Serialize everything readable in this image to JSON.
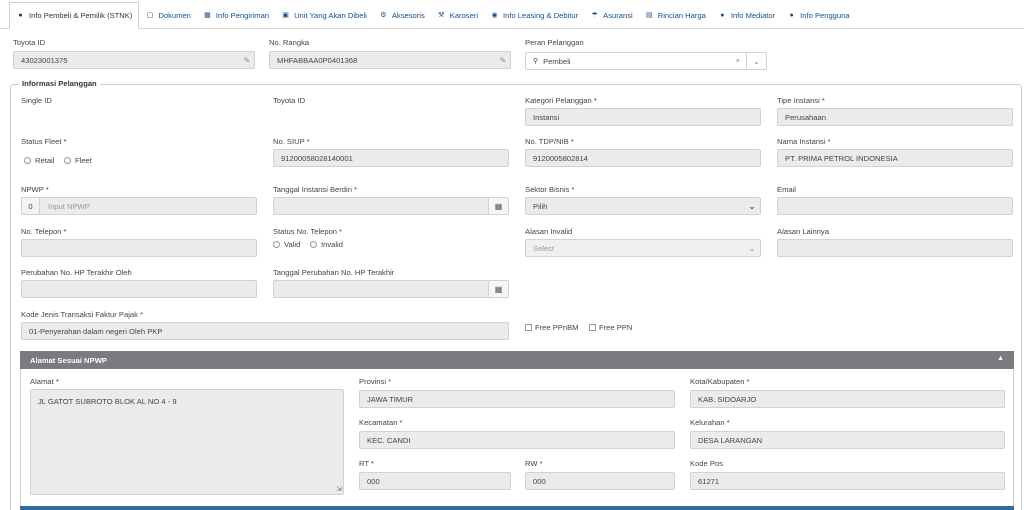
{
  "tabs": [
    {
      "label": "Info Pembeli & Pemilik (STNK)",
      "icon": "user-icon"
    },
    {
      "label": "Dokumen",
      "icon": "folder-icon"
    },
    {
      "label": "Info Pengiriman",
      "icon": "map-icon"
    },
    {
      "label": "Unit Yang Akan Dibeli",
      "icon": "car-icon"
    },
    {
      "label": "Aksesoris",
      "icon": "cogs-icon"
    },
    {
      "label": "Karoseri",
      "icon": "wrench-icon"
    },
    {
      "label": "Info Leasing & Debitur",
      "icon": "handshake-icon"
    },
    {
      "label": "Asuransi",
      "icon": "umbrella-icon"
    },
    {
      "label": "Rincian Harga",
      "icon": "money-icon"
    },
    {
      "label": "Info Mediator",
      "icon": "users-icon"
    },
    {
      "label": "Info Pengguna",
      "icon": "user-icon"
    }
  ],
  "top": {
    "toyota_id_label": "Toyota ID",
    "toyota_id_value": "43023001375",
    "rangka_label": "No. Rangka",
    "rangka_value": "MHFABBAA0P0401368",
    "peran_label": "Peran Pelanggan",
    "peran_value": "Pembeli",
    "clear_symbol": "×",
    "dropdown_symbol": "⌄"
  },
  "info": {
    "legend": "Informasi Pelanggan",
    "single_id_label": "Single ID",
    "toyota_id_label": "Toyota ID",
    "kategori_label": "Kategori Pelanggan *",
    "kategori_value": "Instansi",
    "tipe_label": "Tipe Instansi *",
    "tipe_value": "Perusahaan",
    "status_fleet_label": "Status Fleet *",
    "retail_label": "Retail",
    "fleet_label": "Fleet",
    "siup_label": "No. SIUP *",
    "siup_value": "91200058028140001",
    "tdp_label": "No. TDP/NIB *",
    "tdp_value": "9120005802814",
    "nama_label": "Nama Instansi *",
    "nama_value": "PT. PRIMA PETROL INDONESIA",
    "npwp_label": "NPWP *",
    "npwp_prefix": "0",
    "npwp_placeholder": "Input NPWP",
    "tgl_berdiri_label": "Tanggal Instansi Berdiri *",
    "sektor_label": "Sektor Bisnis *",
    "sektor_value": "Pilih",
    "email_label": "Email",
    "telepon_label": "No. Telepon *",
    "status_telepon_label": "Status No. Telepon *",
    "valid_label": "Valid",
    "invalid_label": "Invalid",
    "alasan_invalid_label": "Alasan Invalid",
    "alasan_invalid_value": "Select",
    "alasan_lainnya_label": "Alasan Lainnya",
    "perubahan_hp_label": "Perubahan No. HP Terakhir Oleh",
    "tgl_perubahan_label": "Tanggal Perubahan No. HP Terakhir",
    "kode_pajak_label": "Kode Jenis Transaksi Faktur Pajak *",
    "kode_pajak_value": "01-Penyerahan dalam negeri Oleh PKP",
    "free_ppnbm_label": "Free PPnBM",
    "free_ppn_label": "Free PPN"
  },
  "alamat": {
    "header": "Alamat Sesuai NPWP",
    "alamat_label": "Alamat *",
    "alamat_value": "JL GATOT SUBROTO BLOK AL NO 4 - 9",
    "provinsi_label": "Provinsi *",
    "provinsi_value": "JAWA TIMUR",
    "kota_label": "Kota/Kabupaten *",
    "kota_value": "KAB. SIDOARJO",
    "kecamatan_label": "Kecamatan *",
    "kecamatan_value": "KEC. CANDI",
    "kelurahan_label": "Kelurahan *",
    "kelurahan_value": "DESA LARANGAN",
    "rt_label": "RT *",
    "rt_value": "000",
    "rw_label": "RW *",
    "rw_value": "000",
    "kodepos_label": "Kode Pos",
    "kodepos_value": "61271"
  }
}
